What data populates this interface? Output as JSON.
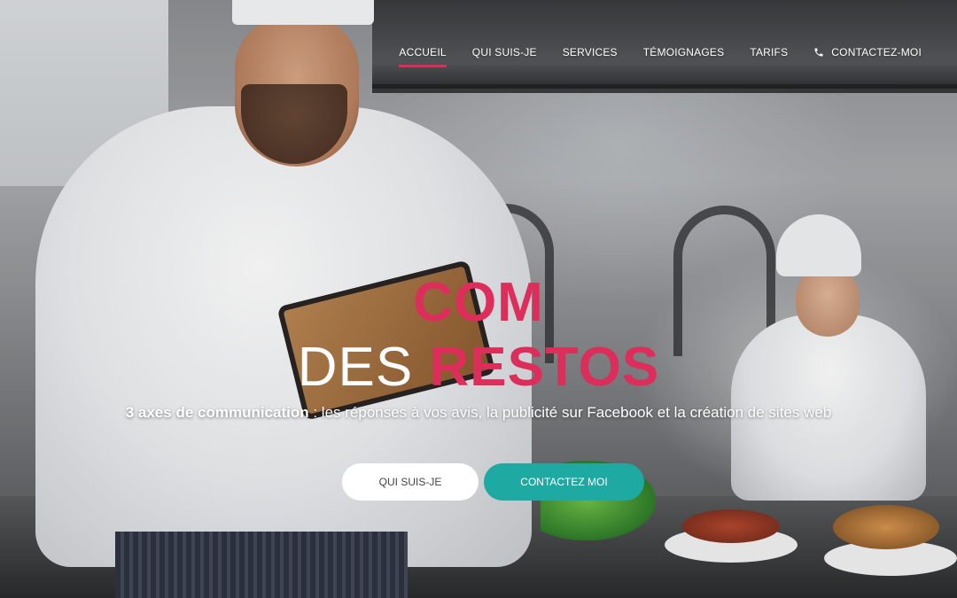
{
  "nav": {
    "items": [
      {
        "label": "ACCUEIL",
        "active": true
      },
      {
        "label": "QUI SUIS-JE",
        "active": false
      },
      {
        "label": "SERVICES",
        "active": false
      },
      {
        "label": "TÉMOIGNAGES",
        "active": false
      },
      {
        "label": "TARIFS",
        "active": false
      }
    ],
    "contact": {
      "label": "CONTACTEZ-MOI",
      "icon": "phone-icon"
    }
  },
  "hero": {
    "title_line1": "COM",
    "title_line2_thin": "DES",
    "title_line2_bold": "RESTOS",
    "tagline_bold": "3 axes de communication",
    "tagline_rest": " : les réponses à vos avis, la publicité sur Facebook et la création de sites web",
    "buttons": {
      "primary": "QUI SUIS-JE",
      "secondary": "CONTACTEZ MOI"
    }
  },
  "colors": {
    "accent": "#dd2d5a",
    "teal": "#1fa9a3",
    "white": "#ffffff"
  }
}
